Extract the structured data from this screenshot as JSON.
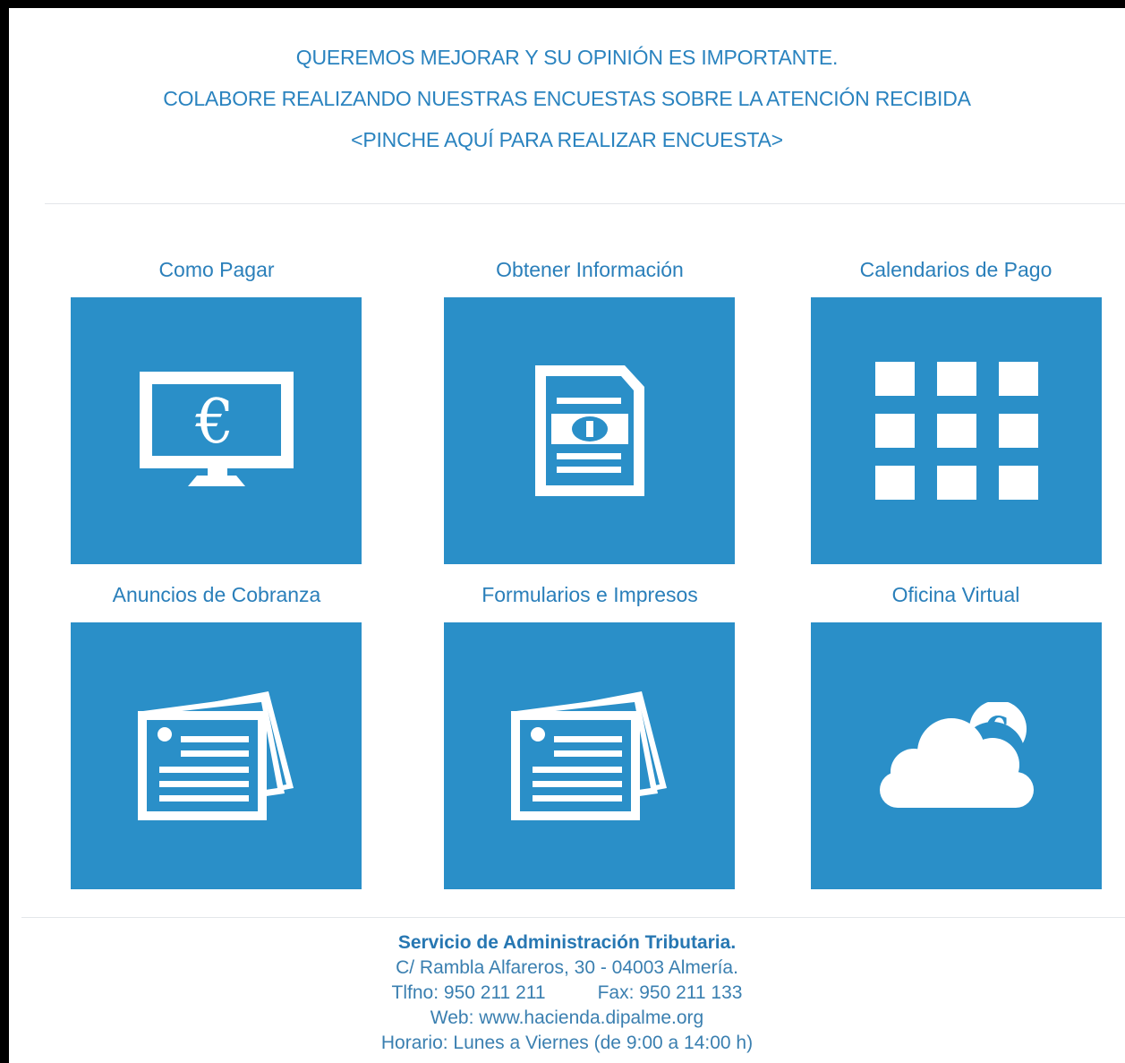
{
  "banner": {
    "line1": "QUEREMOS MEJORAR Y SU  OPINIÓN ES IMPORTANTE.",
    "line2": "COLABORE REALIZANDO NUESTRAS ENCUESTAS SOBRE LA ATENCIÓN RECIBIDA",
    "link": "<PINCHE AQUÍ PARA REALIZAR ENCUESTA>"
  },
  "tiles": [
    {
      "label": "Como Pagar",
      "icon": "monitor-euro-icon"
    },
    {
      "label": "Obtener Información",
      "icon": "document-coin-icon"
    },
    {
      "label": "Calendarios de Pago",
      "icon": "calendar-grid-icon"
    },
    {
      "label": "Anuncios de Cobranza",
      "icon": "newspaper-icon"
    },
    {
      "label": "Formularios e Impresos",
      "icon": "forms-icon"
    },
    {
      "label": "Oficina Virtual",
      "icon": "cloud-euro-icon"
    }
  ],
  "footer": {
    "org": "Servicio de Administración Tributaria.",
    "address": "C/ Rambla Alfareros, 30 - 04003 Almería.",
    "phone": "Tlfno:  950 211 211",
    "fax": "Fax: 950 211 133",
    "web": "Web:   www.hacienda.dipalme.org",
    "hours": "Horario:  Lunes a Viernes (de 9:00 a 14:00 h)"
  },
  "colors": {
    "tile": "#2a8fc8",
    "text": "#2a83bf",
    "frame": "#000000"
  }
}
